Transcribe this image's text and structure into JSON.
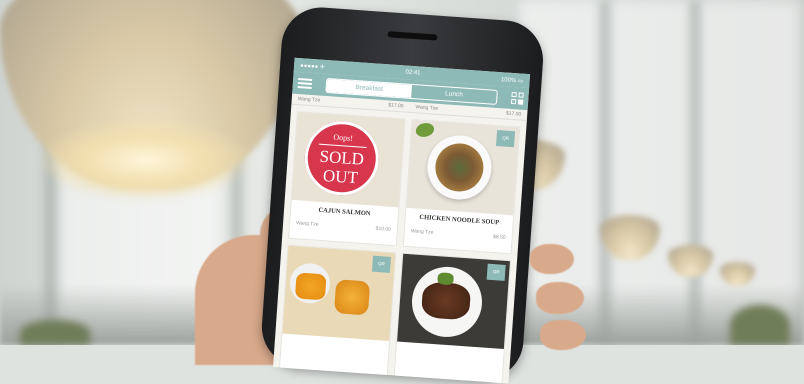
{
  "status_bar": {
    "carrier": "●●●●● ✈",
    "time": "02:41",
    "battery": "100% ▭"
  },
  "appbar": {
    "menu_icon": "hamburger-menu-icon",
    "segments": [
      "Breakfast",
      "Lunch"
    ],
    "active_segment": 0,
    "qr_icon": "qr-code-icon"
  },
  "top_row": [
    {
      "left": "Wang Tze",
      "right": "$17.00"
    },
    {
      "left": "Wang Tze",
      "right": "$17.00"
    }
  ],
  "cards": [
    {
      "name": "CAJUN SALMON",
      "restaurant": "Wang Tze",
      "price": "$10.00",
      "sold_out": {
        "line1": "Oops!",
        "line2": "SOLD",
        "line3": "OUT"
      }
    },
    {
      "name": "CHICKEN NOODLE SOUP",
      "restaurant": "Wang Tze",
      "price": "$8.50",
      "badge": "QR"
    },
    {
      "name": "",
      "restaurant": "",
      "price": "",
      "badge": "QR"
    },
    {
      "name": "",
      "restaurant": "",
      "price": "",
      "badge": "QR"
    }
  ],
  "colors": {
    "accent": "#8dbab7",
    "sold_out": "#d8364d"
  }
}
